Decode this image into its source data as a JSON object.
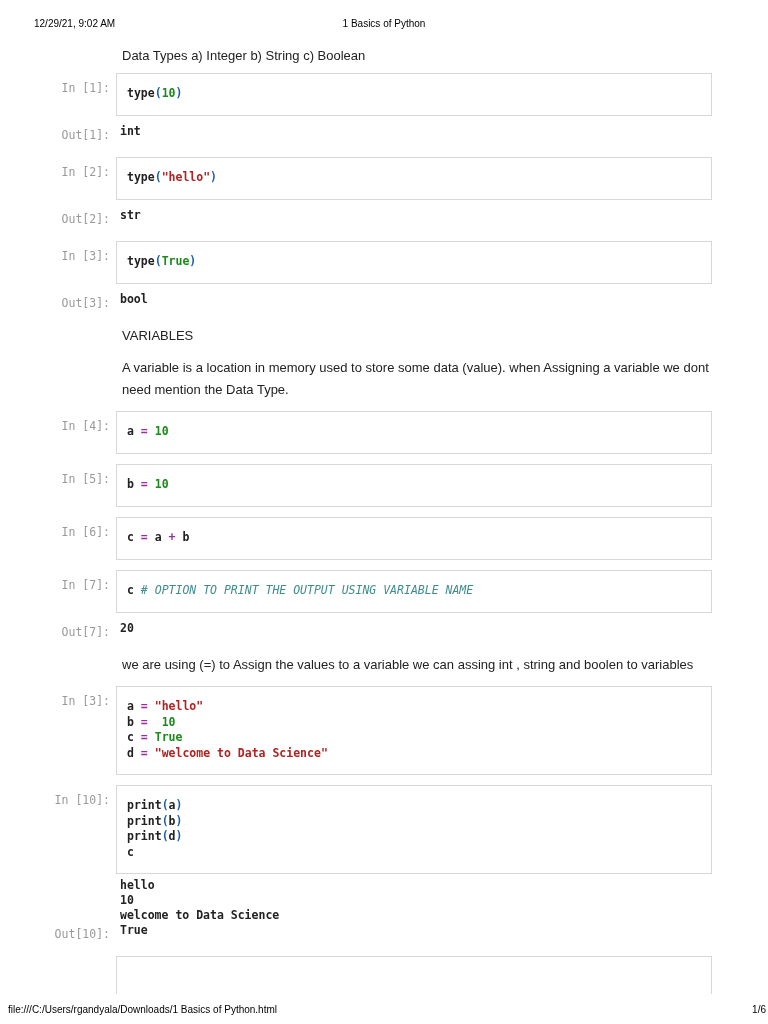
{
  "header": {
    "date": "12/29/21, 9:02 AM",
    "title": "1 Basics of Python"
  },
  "cells": [
    {
      "kind": "markdown",
      "text": "Data Types a) Integer b) String c) Boolean"
    },
    {
      "kind": "code",
      "prompt": "In [1]:",
      "lines": [
        [
          {
            "text": "type",
            "kind": "plain"
          },
          {
            "text": "(",
            "kind": "paren"
          },
          {
            "text": "10",
            "kind": "num"
          },
          {
            "text": ")",
            "kind": "paren"
          }
        ]
      ]
    },
    {
      "kind": "output",
      "prompt": "Out[1]:",
      "lines": [
        "int"
      ]
    },
    {
      "kind": "code",
      "prompt": "In [2]:",
      "lines": [
        [
          {
            "text": "type",
            "kind": "plain"
          },
          {
            "text": "(",
            "kind": "paren"
          },
          {
            "text": "\"hello\"",
            "kind": "str"
          },
          {
            "text": ")",
            "kind": "paren"
          }
        ]
      ]
    },
    {
      "kind": "output",
      "prompt": "Out[2]:",
      "lines": [
        "str"
      ]
    },
    {
      "kind": "code",
      "prompt": "In [3]:",
      "lines": [
        [
          {
            "text": "type",
            "kind": "plain"
          },
          {
            "text": "(",
            "kind": "paren"
          },
          {
            "text": "True",
            "kind": "num"
          },
          {
            "text": ")",
            "kind": "paren"
          }
        ]
      ]
    },
    {
      "kind": "output",
      "prompt": "Out[3]:",
      "lines": [
        "bool"
      ]
    },
    {
      "kind": "markdown",
      "text": "VARIABLES"
    },
    {
      "kind": "markdown",
      "text": "A variable is a location in memory used to store some data (value). when Assigning a variable we dont need mention the Data Type."
    },
    {
      "kind": "code",
      "prompt": "In [4]:",
      "lines": [
        [
          {
            "text": "a ",
            "kind": "plain"
          },
          {
            "text": "=",
            "kind": "op"
          },
          {
            "text": " 10",
            "kind": "num"
          }
        ]
      ]
    },
    {
      "kind": "code",
      "prompt": "In [5]:",
      "lines": [
        [
          {
            "text": "b ",
            "kind": "plain"
          },
          {
            "text": "=",
            "kind": "op"
          },
          {
            "text": " 10",
            "kind": "num"
          }
        ]
      ]
    },
    {
      "kind": "code",
      "prompt": "In [6]:",
      "lines": [
        [
          {
            "text": "c ",
            "kind": "plain"
          },
          {
            "text": "=",
            "kind": "op"
          },
          {
            "text": " a ",
            "kind": "plain"
          },
          {
            "text": "+",
            "kind": "op"
          },
          {
            "text": " b",
            "kind": "plain"
          }
        ]
      ]
    },
    {
      "kind": "code",
      "prompt": "In [7]:",
      "lines": [
        [
          {
            "text": "c ",
            "kind": "plain"
          },
          {
            "text": "# OPTION TO PRINT THE OUTPUT USING VARIABLE NAME",
            "kind": "comment"
          }
        ]
      ]
    },
    {
      "kind": "output",
      "prompt": "Out[7]:",
      "lines": [
        "20"
      ]
    },
    {
      "kind": "markdown",
      "text": "we are using (=) to Assign the values to a variable we can assing int , string and boolen to variables"
    },
    {
      "kind": "code",
      "prompt": "In [3]:",
      "lines": [
        [
          {
            "text": "a ",
            "kind": "plain"
          },
          {
            "text": "=",
            "kind": "op"
          },
          {
            "text": " \"hello\"",
            "kind": "str"
          }
        ],
        [
          {
            "text": "b ",
            "kind": "plain"
          },
          {
            "text": "=",
            "kind": "op"
          },
          {
            "text": "  10",
            "kind": "num"
          }
        ],
        [
          {
            "text": "c ",
            "kind": "plain"
          },
          {
            "text": "=",
            "kind": "op"
          },
          {
            "text": " True",
            "kind": "num"
          }
        ],
        [
          {
            "text": "d ",
            "kind": "plain"
          },
          {
            "text": "=",
            "kind": "op"
          },
          {
            "text": " \"welcome to Data Science\"",
            "kind": "str"
          }
        ]
      ]
    },
    {
      "kind": "code",
      "prompt": "In [10]:",
      "lines": [
        [
          {
            "text": "print",
            "kind": "plain"
          },
          {
            "text": "(",
            "kind": "paren"
          },
          {
            "text": "a",
            "kind": "plain"
          },
          {
            "text": ")",
            "kind": "paren"
          }
        ],
        [
          {
            "text": "print",
            "kind": "plain"
          },
          {
            "text": "(",
            "kind": "paren"
          },
          {
            "text": "b",
            "kind": "plain"
          },
          {
            "text": ")",
            "kind": "paren"
          }
        ],
        [
          {
            "text": "print",
            "kind": "plain"
          },
          {
            "text": "(",
            "kind": "paren"
          },
          {
            "text": "d",
            "kind": "plain"
          },
          {
            "text": ")",
            "kind": "paren"
          }
        ],
        [
          {
            "text": "c",
            "kind": "plain"
          }
        ]
      ]
    },
    {
      "kind": "stream",
      "lines": [
        "hello",
        "10",
        "welcome to Data Science"
      ]
    },
    {
      "kind": "output",
      "prompt": "Out[10]:",
      "lines": [
        "True"
      ]
    },
    {
      "kind": "empty_code"
    }
  ],
  "footer": {
    "path": "file:///C:/Users/rgandyala/Downloads/1 Basics of Python.html",
    "page": "1/6"
  }
}
